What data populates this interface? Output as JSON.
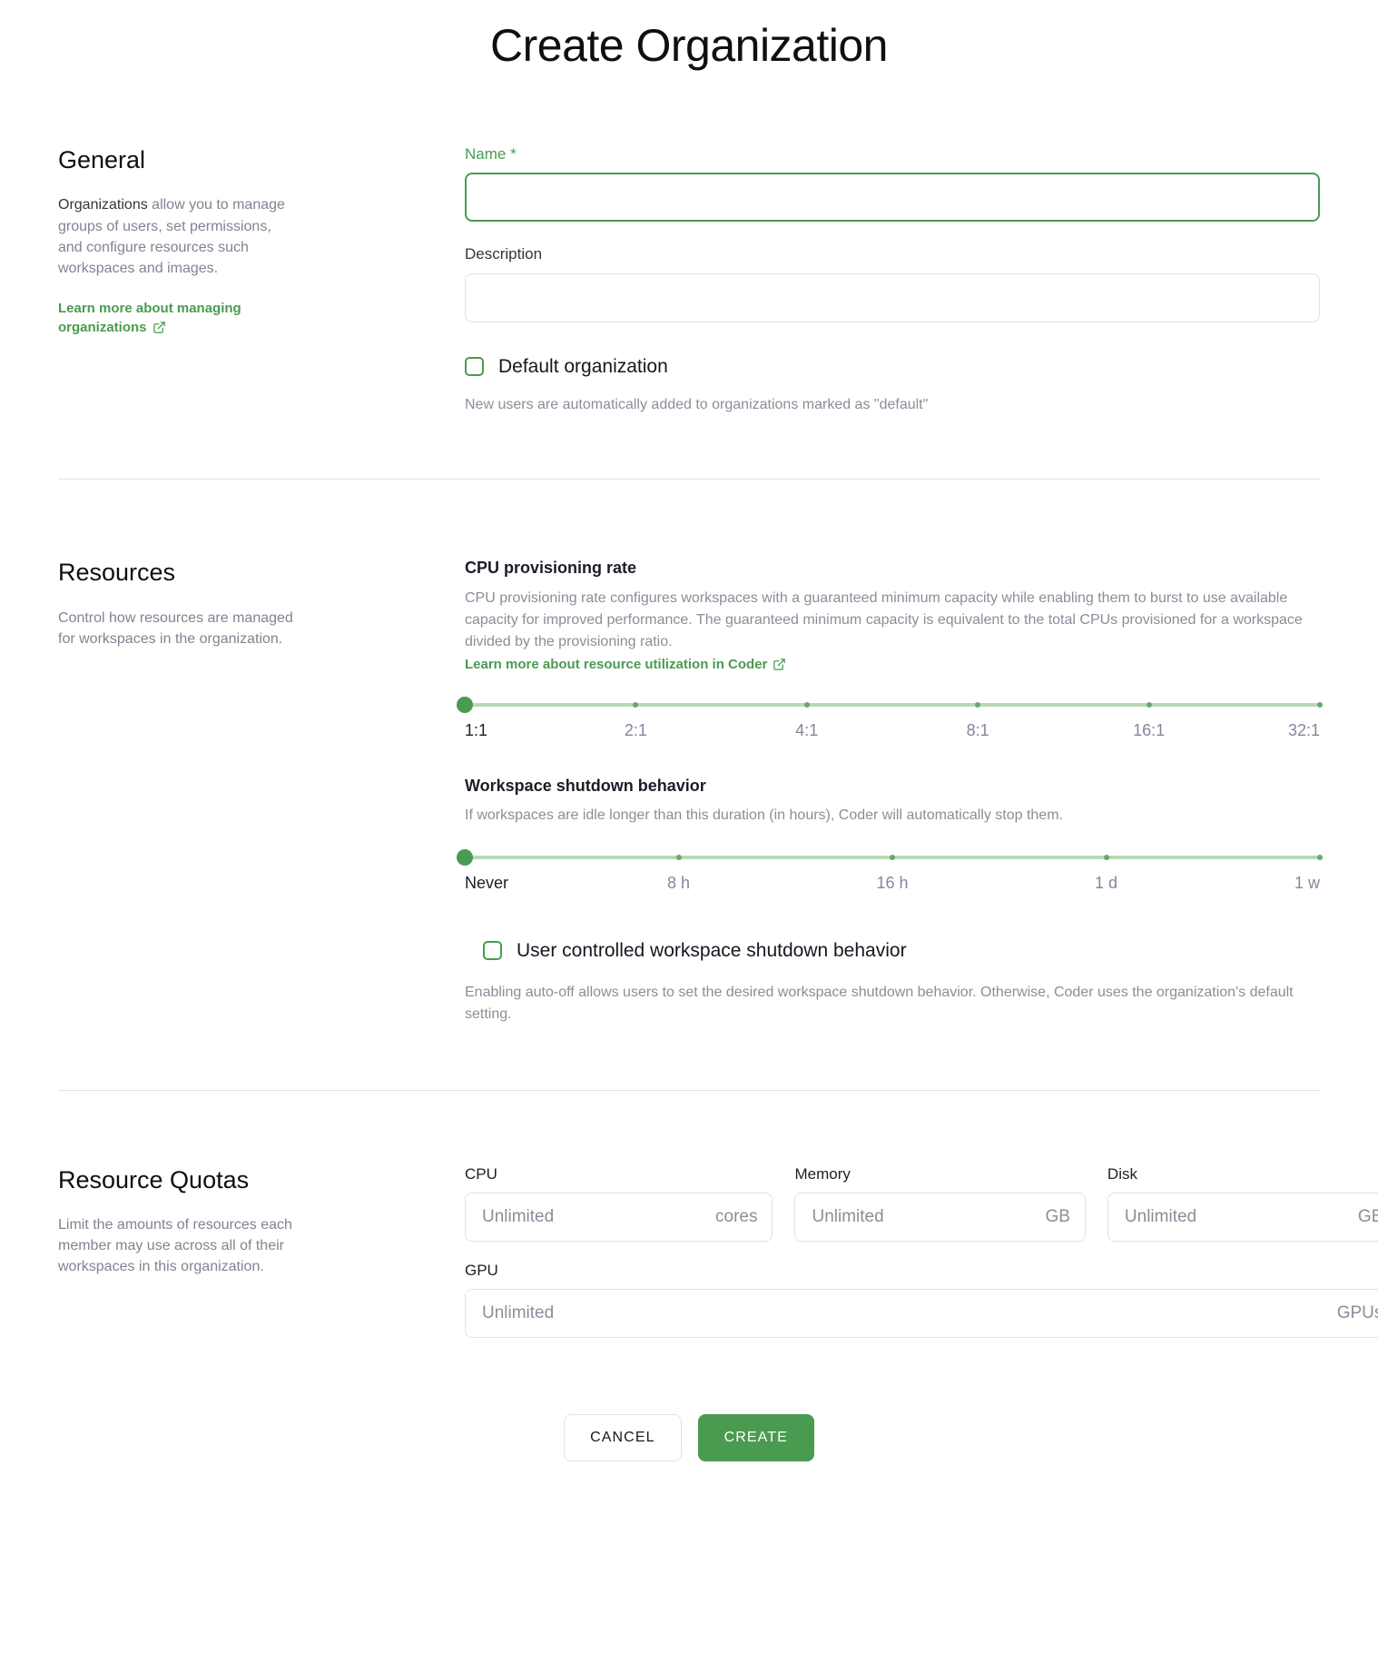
{
  "page": {
    "title": "Create Organization"
  },
  "theme": {
    "accent_green": "#4a9b50",
    "link_green": "#4a9b50",
    "border": "#dfe2ed",
    "muted_text": "#8a8e99"
  },
  "general": {
    "heading": "General",
    "desc_lead": "Organizations",
    "desc_rest": " allow you to manage groups of users, set permissions, and configure resources such workspaces and images.",
    "learn_more": "Learn more about managing organizations",
    "learn_more_icon": "external-link-icon",
    "name_label": "Name *",
    "name_value": "",
    "name_placeholder": "",
    "description_label": "Description",
    "description_value": "",
    "description_placeholder": "",
    "default_org_label": "Default organization",
    "default_org_checked": false,
    "default_org_helper": "New users are automatically added to organizations marked as \"default\""
  },
  "resources": {
    "heading": "Resources",
    "desc": "Control how resources are managed for workspaces in the organization.",
    "cpu": {
      "title": "CPU provisioning rate",
      "desc": "CPU provisioning rate configures workspaces with a guaranteed minimum capacity while enabling them to burst to use available capacity for improved performance. The guaranteed minimum capacity is equivalent to the total CPUs provisioned for a workspace divided by the provisioning ratio.",
      "learn_more": "Learn more about resource utilization in Coder",
      "learn_more_icon": "external-link-icon",
      "marks": [
        "1:1",
        "2:1",
        "4:1",
        "8:1",
        "16:1",
        "32:1"
      ],
      "selected_index": 0,
      "selected_value": "1:1"
    },
    "shutdown": {
      "title": "Workspace shutdown behavior",
      "desc": "If workspaces are idle longer than this duration (in hours), Coder will automatically stop them.",
      "marks": [
        "Never",
        "8 h",
        "16 h",
        "1 d",
        "1 w"
      ],
      "selected_index": 0,
      "selected_value": "Never"
    },
    "user_controlled_label": "User controlled workspace shutdown behavior",
    "user_controlled_checked": false,
    "user_controlled_helper": "Enabling auto-off allows users to set the desired workspace shutdown behavior. Otherwise, Coder uses the organization's default setting."
  },
  "quotas": {
    "heading": "Resource Quotas",
    "desc": "Limit the amounts of resources each member may use across all of their workspaces in this organization.",
    "fields": [
      {
        "label": "CPU",
        "placeholder": "Unlimited",
        "unit": "cores",
        "value": ""
      },
      {
        "label": "Memory",
        "placeholder": "Unlimited",
        "unit": "GB",
        "value": ""
      },
      {
        "label": "Disk",
        "placeholder": "Unlimited",
        "unit": "GB",
        "value": ""
      }
    ],
    "gpu": {
      "label": "GPU",
      "placeholder": "Unlimited",
      "unit": "GPUs",
      "value": ""
    }
  },
  "actions": {
    "cancel": "CANCEL",
    "create": "CREATE"
  }
}
